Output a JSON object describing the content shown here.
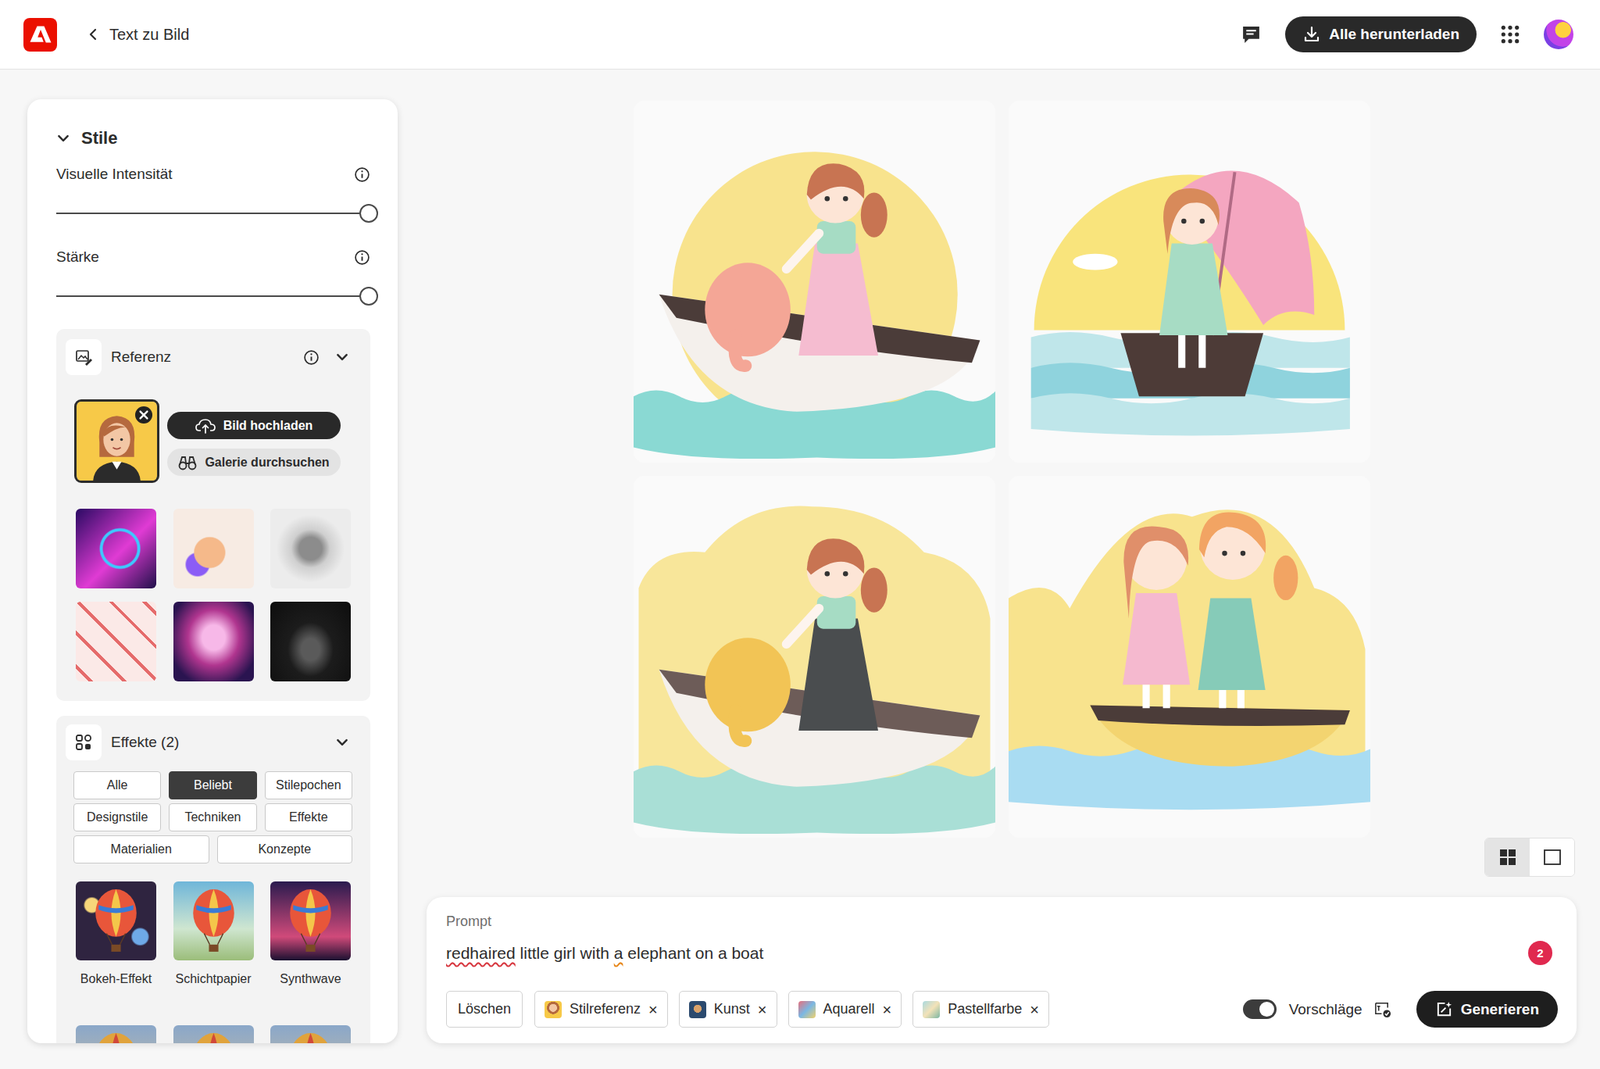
{
  "header": {
    "title": "Text zu Bild",
    "download_button": "Alle herunterladen"
  },
  "styles": {
    "title": "Stile",
    "expanded": true,
    "sliders": [
      {
        "label": "Visuelle Intensität",
        "level": 1
      },
      {
        "label": "Stärke",
        "level": 1
      }
    ]
  },
  "reference": {
    "title": "Referenz",
    "expanded": true,
    "current": {
      "selected": true
    },
    "upload_button": "Bild hochladen",
    "gallery_button": "Galerie durchsuchen",
    "gallery": [
      {
        "selected": false
      },
      {
        "selected": false
      },
      {
        "selected": false
      },
      {
        "selected": false
      },
      {
        "selected": false
      },
      {
        "selected": false
      }
    ]
  },
  "effects": {
    "title": "Effekte (2)",
    "expanded": true,
    "filters": [
      {
        "label": "Alle",
        "selected": false
      },
      {
        "label": "Beliebt",
        "selected": true
      },
      {
        "label": "Stilepochen",
        "selected": false
      },
      {
        "label": "Designstile",
        "selected": false
      },
      {
        "label": "Techniken",
        "selected": false
      },
      {
        "label": "Effekte",
        "selected": false
      },
      {
        "label": "Materialien",
        "selected": false
      },
      {
        "label": "Konzepte",
        "selected": false
      }
    ],
    "items": [
      {
        "label": "Bokeh-Effekt",
        "selected": false
      },
      {
        "label": "Schichtpapier",
        "selected": false
      },
      {
        "label": "Synthwave",
        "selected": false
      }
    ],
    "more_items": [
      {
        "selected": false
      },
      {
        "selected": false
      },
      {
        "selected": false
      }
    ]
  },
  "results": {
    "images": [
      {
        "kind": "girl-elephant"
      },
      {
        "kind": "girl-umbrella"
      },
      {
        "kind": "girl-elephant-yellow"
      },
      {
        "kind": "two-girls"
      }
    ]
  },
  "view_modes": [
    {
      "kind": "grid",
      "selected": true
    },
    {
      "kind": "single",
      "selected": false
    }
  ],
  "prompt": {
    "label": "Prompt",
    "segments": [
      {
        "text": "redhaired",
        "mark": "spelling"
      },
      {
        "text": " little girl with ",
        "mark": "none"
      },
      {
        "text": "a",
        "mark": "grammar"
      },
      {
        "text": " elephant on a boat",
        "mark": "none"
      }
    ],
    "badge": "2",
    "clear_button": "Löschen",
    "chips": [
      {
        "label": "Stilreferenz",
        "remove": "×"
      },
      {
        "label": "Kunst",
        "remove": "×"
      },
      {
        "label": "Aquarell",
        "remove": "×"
      },
      {
        "label": "Pastellfarbe",
        "remove": "×"
      }
    ],
    "suggestions": {
      "label": "Vorschläge",
      "on": true
    },
    "generate_button": "Generieren"
  }
}
